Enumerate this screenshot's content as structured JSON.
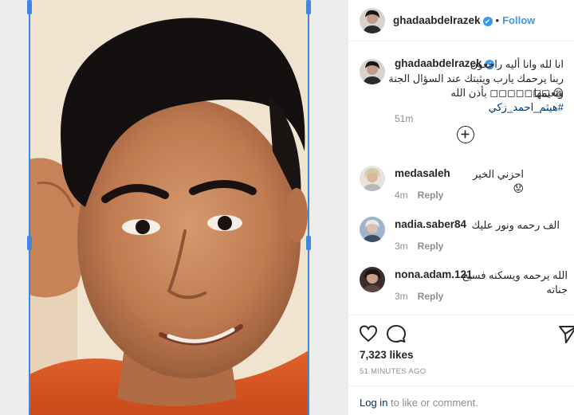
{
  "post": {
    "author": "ghadaabdelrazek",
    "follow_label": "Follow",
    "dot": "•",
    "verified_mark": "✔",
    "caption_line1": "انا لله وانا أليه راجعون",
    "caption_line2": "ربنا يرحمك يارب ويثبتك عند السؤال الجنة ونعيمها",
    "caption_line3_prefix": "😪 ◻◻◻◻◻◻◻ بأذن الله ",
    "caption_hashtag": "#هيثم_احمد_زكي",
    "caption_time": "51m",
    "likes": "7,323 likes",
    "time_ago": "51 MINUTES AGO",
    "login_link": "Log in",
    "login_text": " to like or comment."
  },
  "comments": [
    {
      "user": "medasaleh",
      "text": "احزني الخير 😟",
      "time": "4m",
      "reply": "Reply"
    },
    {
      "user": "nadia.saber84",
      "text": "الف رحمه ونور عليك",
      "time": "3m",
      "reply": "Reply"
    },
    {
      "user": "nona.adam.121",
      "text": "الله يرحمه ويسكنه فسيح جناته",
      "time": "3m",
      "reply": "Reply"
    }
  ],
  "icons": [
    "heart-icon",
    "comment-icon",
    "share-icon",
    "plus-circle-icon",
    "verified-icon"
  ],
  "colors": {
    "accent": "#3897f0",
    "link": "#003569",
    "muted": "#8e8e8e",
    "selection": "#3f86e0"
  }
}
